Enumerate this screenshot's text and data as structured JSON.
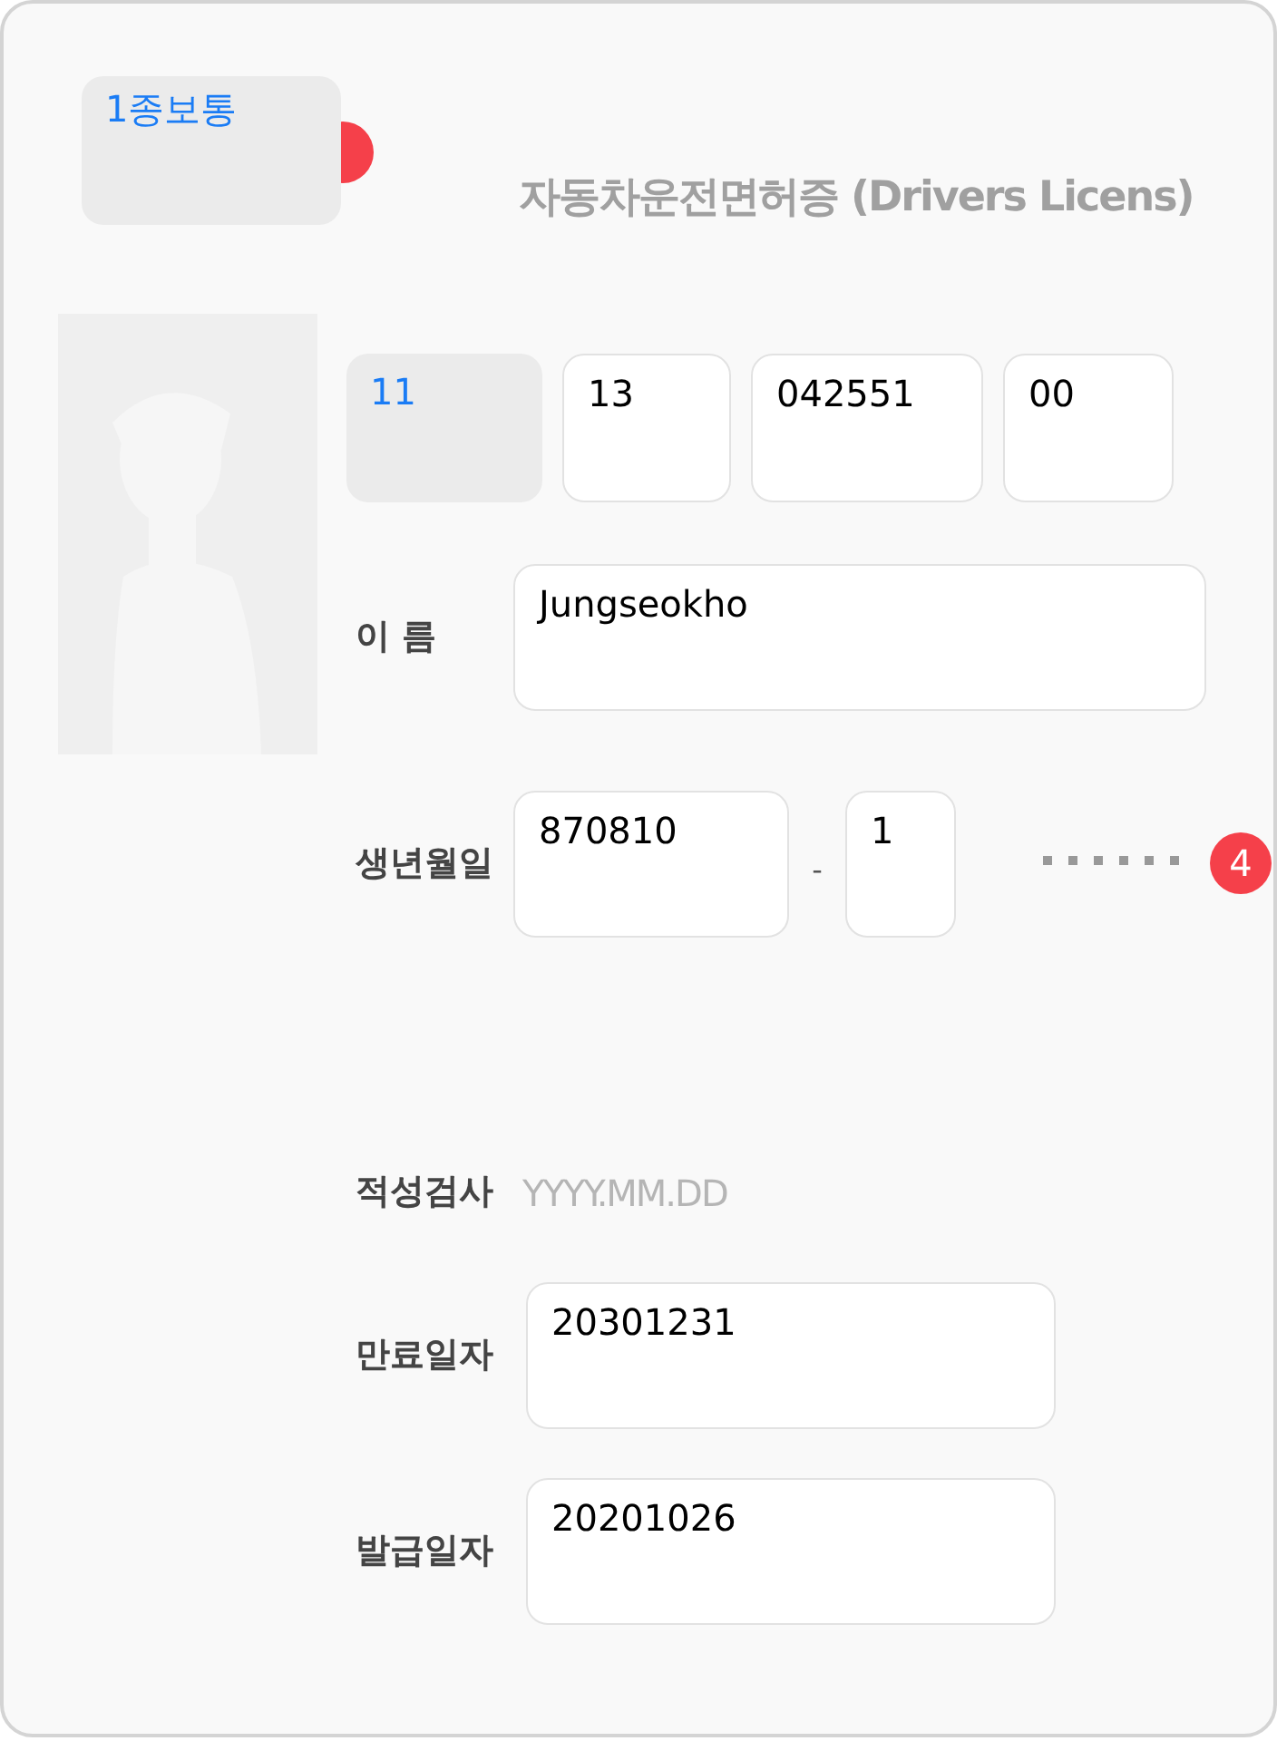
{
  "license_type": {
    "value": "1종보통",
    "kind": "picker"
  },
  "title": "자동차운전면허증 (Drivers Licens)",
  "number_fields": [
    {
      "value": "11",
      "kind": "picker"
    },
    {
      "value": "13",
      "kind": "input"
    },
    {
      "value": "042551",
      "kind": "input"
    },
    {
      "value": "00",
      "kind": "input"
    }
  ],
  "name": {
    "label": "이 름",
    "value": "Jungseokho"
  },
  "birth": {
    "label": "생년월일",
    "front": "870810",
    "separator": "-",
    "back": "1"
  },
  "aptitude": {
    "label": "적성검사",
    "placeholder": "YYYY.MM.DD"
  },
  "dates": [
    {
      "label": "만료일자",
      "value": "20301231"
    },
    {
      "label": "발급일자",
      "value": "20201026"
    }
  ],
  "badge": {
    "text": "4"
  }
}
